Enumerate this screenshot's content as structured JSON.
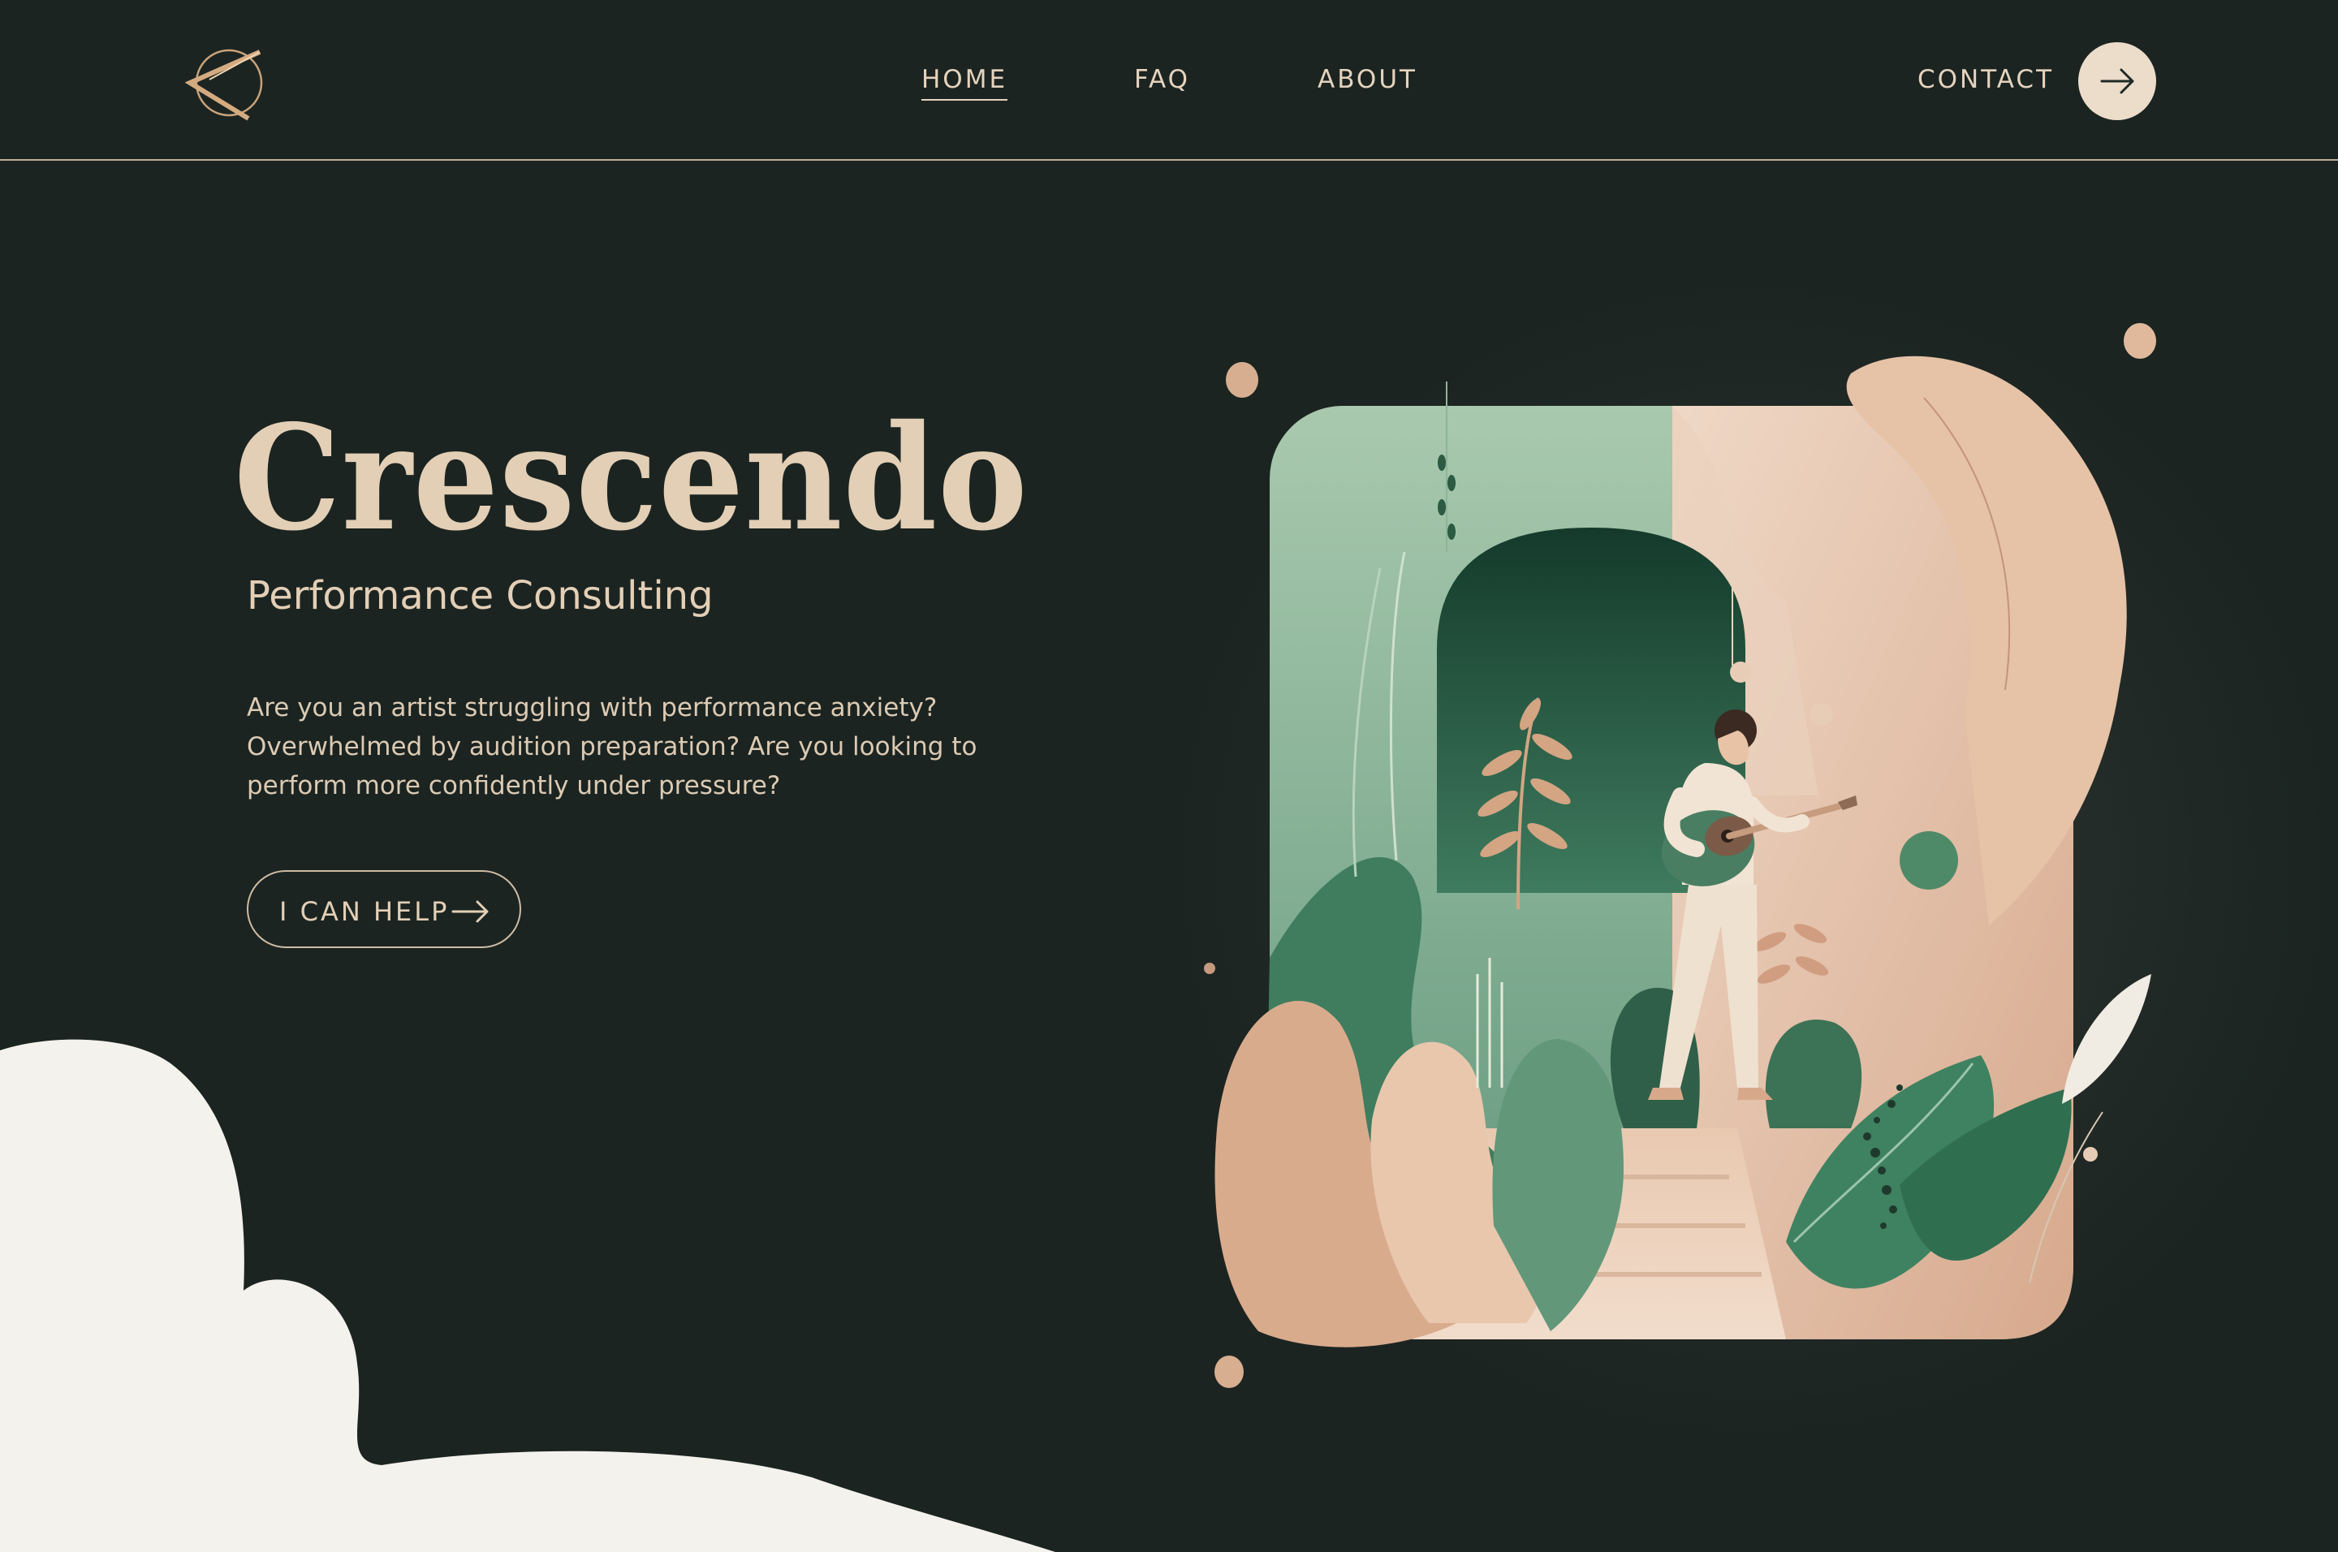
{
  "nav": {
    "home": "HOME",
    "faq": "FAQ",
    "about": "ABOUT",
    "contact": "CONTACT",
    "active": "HOME"
  },
  "hero": {
    "title": "Crescendo",
    "subtitle": "Performance Consulting",
    "description_lines": [
      "Are you an artist struggling with performance anxiety?",
      "Overwhelmed by audition preparation? Are you looking to",
      "perform more confidently under pressure?"
    ],
    "cta_label": "I CAN HELP"
  },
  "icons": {
    "logo": "chevron-left-logo-icon",
    "contact_arrow": "arrow-right-icon",
    "cta_arrow": "arrow-right-icon"
  },
  "colors": {
    "background": "#1b2421",
    "accent_cream": "#ecdcca",
    "text_beige": "#e3cfb6",
    "blob_cream": "#f4f2ec",
    "illustration_green": "#4f8a68",
    "illustration_peach": "#dcb39a"
  }
}
